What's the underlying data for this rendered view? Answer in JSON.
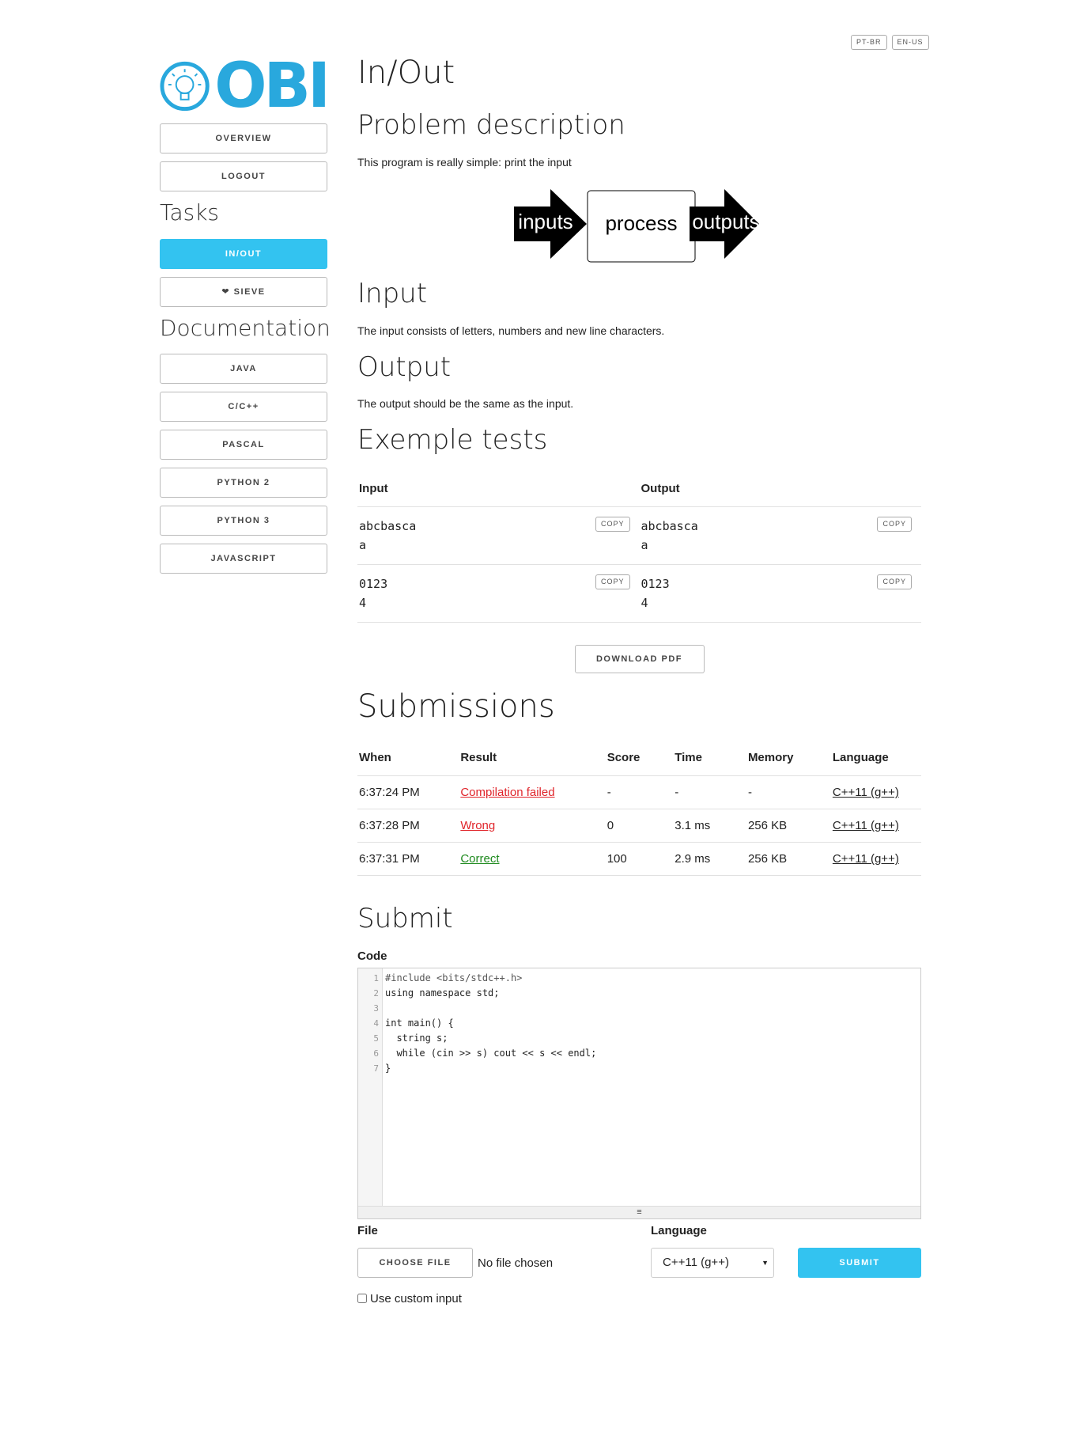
{
  "languages": [
    "PT-BR",
    "EN-US"
  ],
  "logo": {
    "text": "OBI"
  },
  "sidebar": {
    "overview": "OVERVIEW",
    "logout": "LOGOUT",
    "tasks_heading": "Tasks",
    "tasks": [
      "IN/OUT",
      "❤ SIEVE"
    ],
    "docs_heading": "Documentation",
    "docs": [
      "JAVA",
      "C/C++",
      "PASCAL",
      "PYTHON 2",
      "PYTHON 3",
      "JAVASCRIPT"
    ]
  },
  "main": {
    "title": "In/Out",
    "problem_heading": "Problem description",
    "problem_text": "This program is really simple: print the input",
    "diagram": {
      "left": "inputs",
      "middle": "process",
      "right": "outputs"
    },
    "input_heading": "Input",
    "input_text": "The input consists of letters, numbers and new line characters.",
    "output_heading": "Output",
    "output_text": "The output should be the same as the input.",
    "examples_heading": "Exemple tests",
    "examples_headers": [
      "Input",
      "Output"
    ],
    "examples": [
      {
        "input": "abcbasca\na",
        "output": "abcbasca\na"
      },
      {
        "input": "0123\n4",
        "output": "0123\n4"
      }
    ],
    "copy_label": "COPY",
    "download_pdf": "DOWNLOAD PDF",
    "submissions_heading": "Submissions",
    "submissions_headers": [
      "When",
      "Result",
      "Score",
      "Time",
      "Memory",
      "Language"
    ],
    "submissions": [
      {
        "when": "6:37:24 PM",
        "result": "Compilation failed",
        "score": "-",
        "time": "-",
        "memory": "-",
        "language": "C++11 (g++)"
      },
      {
        "when": "6:37:28 PM",
        "result": "Wrong",
        "score": "0",
        "time": "3.1 ms",
        "memory": "256 KB",
        "language": "C++11 (g++)"
      },
      {
        "when": "6:37:31 PM",
        "result": "Correct",
        "score": "100",
        "time": "2.9 ms",
        "memory": "256 KB",
        "language": "C++11 (g++)"
      }
    ],
    "submit_heading": "Submit",
    "code_label": "Code",
    "code_line_numbers": [
      "1",
      "2",
      "3",
      "4",
      "5",
      "6",
      "7"
    ],
    "code_lines": [
      "#include <bits/stdc++.h>",
      "using namespace std;",
      "",
      "int main() {",
      "  string s;",
      "  while (cin >> s) cout << s << endl;",
      "}"
    ],
    "file_label": "File",
    "choose_file": "CHOOSE FILE",
    "no_file": "No file chosen",
    "language_label": "Language",
    "language_value": "C++11 (g++)",
    "submit_button": "SUBMIT",
    "custom_input_label": "Use custom input"
  },
  "colors": {
    "accent": "#33c3f0",
    "logo": "#29a8dd",
    "wrong": "#e0242a",
    "correct": "#1e8a1e"
  }
}
